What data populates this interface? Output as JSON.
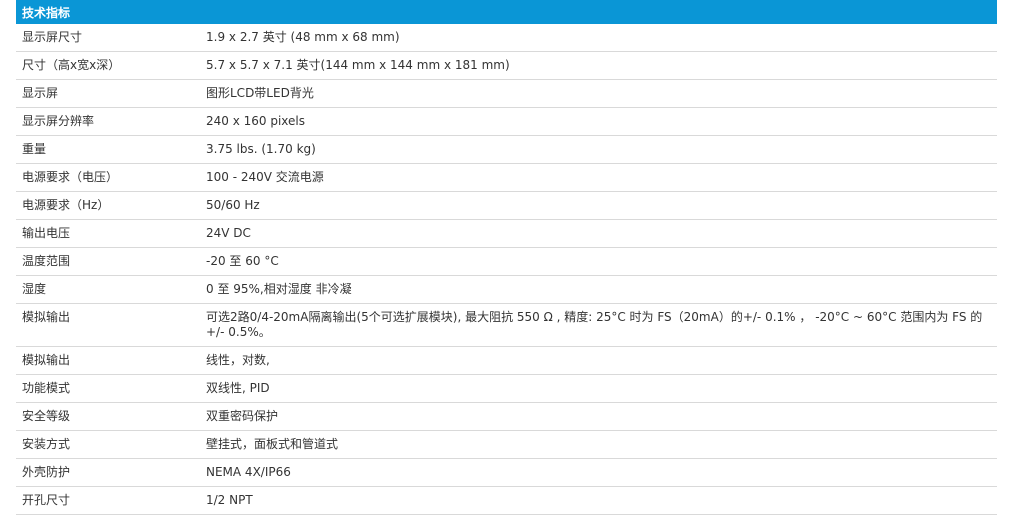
{
  "header": {
    "title": "技术指标"
  },
  "specs": [
    {
      "label": "显示屏尺寸",
      "value": "1.9 x 2.7 英寸 (48 mm x 68 mm)"
    },
    {
      "label": "尺寸（高x宽x深）",
      "value": "5.7 x 5.7 x 7.1 英寸(144 mm x 144 mm x 181 mm)"
    },
    {
      "label": "显示屏",
      "value": "图形LCD带LED背光"
    },
    {
      "label": "显示屏分辨率",
      "value": "240 x 160 pixels"
    },
    {
      "label": "重量",
      "value": "3.75 lbs. (1.70 kg)"
    },
    {
      "label": "电源要求（电压）",
      "value": "100 - 240V 交流电源"
    },
    {
      "label": "电源要求（Hz）",
      "value": "50/60 Hz"
    },
    {
      "label": "输出电压",
      "value": "24V DC"
    },
    {
      "label": "温度范围",
      "value": "-20 至 60 °C"
    },
    {
      "label": "湿度",
      "value": "0 至 95%,相对湿度 非冷凝"
    },
    {
      "label": "模拟输出",
      "value": "可选2路0/4-20mA隔离输出(5个可选扩展模块), 最大阻抗 550 Ω , 精度: 25°C 时为 FS（20mA）的+/- 0.1% ， -20°C ~ 60°C 范围内为 FS 的 +/- 0.5%。"
    },
    {
      "label": "模拟输出",
      "value": "线性，对数,"
    },
    {
      "label": "功能模式",
      "value": "双线性, PID"
    },
    {
      "label": "安全等级",
      "value": "双重密码保护"
    },
    {
      "label": "安装方式",
      "value": "壁挂式，面板式和管道式"
    },
    {
      "label": "外壳防护",
      "value": "NEMA 4X/IP66"
    },
    {
      "label": "开孔尺寸",
      "value": "1/2 NPT"
    }
  ]
}
